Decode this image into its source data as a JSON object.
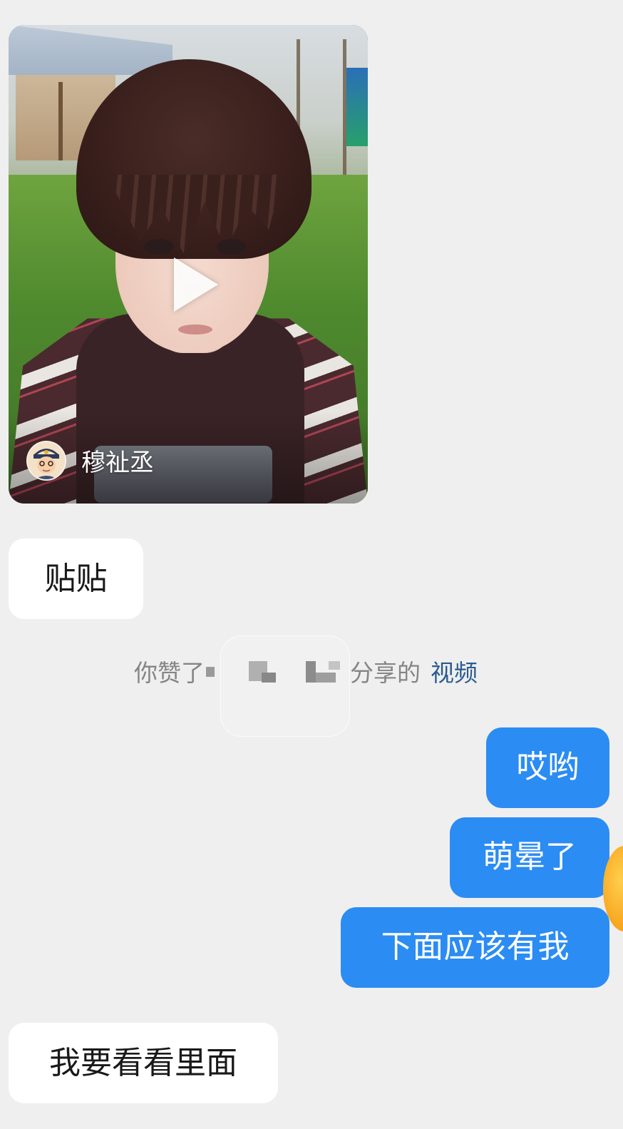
{
  "video_card": {
    "author_name": "穆祉丞",
    "play_icon": "play-icon",
    "avatar_icon": "cartoon-avatar"
  },
  "messages": [
    {
      "id": "msg-1",
      "side": "incoming",
      "text": "贴贴"
    },
    {
      "id": "msg-2",
      "side": "outgoing",
      "text": "哎哟"
    },
    {
      "id": "msg-3",
      "side": "outgoing",
      "text": "萌晕了"
    },
    {
      "id": "msg-4",
      "side": "outgoing",
      "text": "下面应该有我"
    },
    {
      "id": "msg-5",
      "side": "incoming",
      "text": "我要看看里面"
    }
  ],
  "system_notice": {
    "prefix": "你赞了",
    "suffix": "分享的",
    "link": "视频"
  },
  "colors": {
    "background": "#efefef",
    "incoming_bubble": "#ffffff",
    "outgoing_bubble": "#2b8cf3",
    "notice_text": "#858585",
    "link_text": "#2b5a8f"
  }
}
